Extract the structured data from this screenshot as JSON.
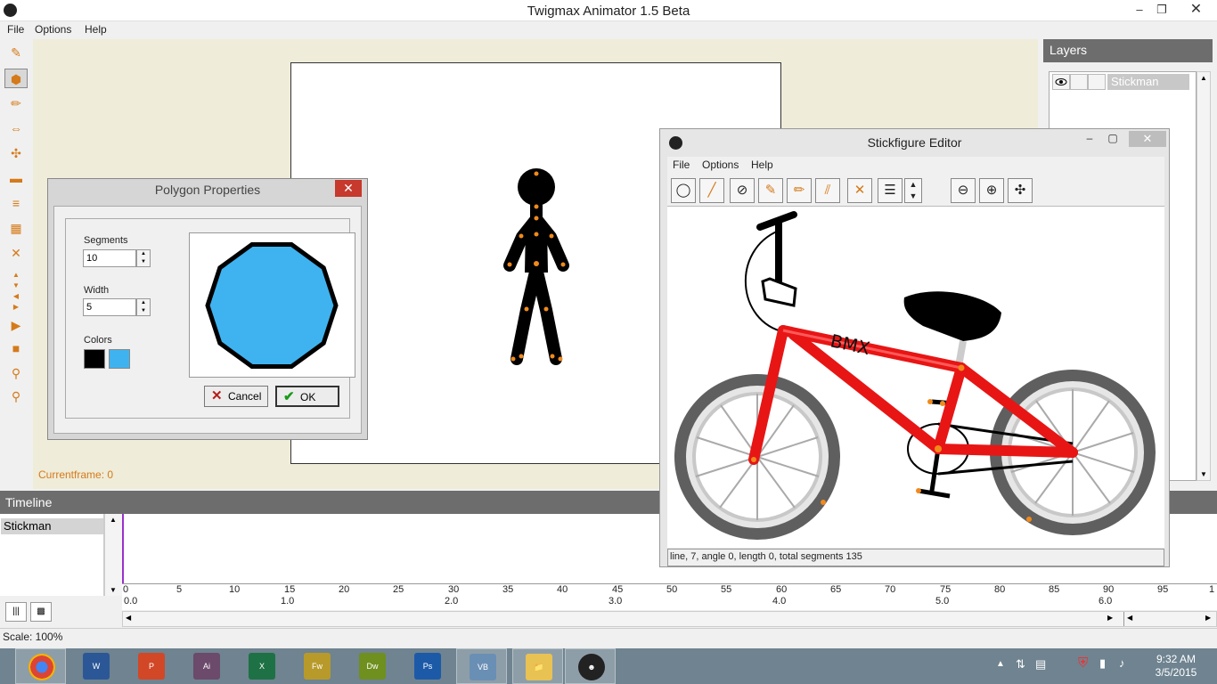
{
  "app": {
    "title": "Twigmax Animator 1.5 Beta",
    "menu": [
      "File",
      "Options",
      "Help"
    ],
    "window_controls": [
      "–",
      "❐",
      "✕"
    ]
  },
  "toolbar": {
    "tools": [
      "brush-icon",
      "polygon-icon",
      "pencil-icon",
      "resize-icon",
      "scale-icon",
      "move-icon",
      "align-icon",
      "layers-icon",
      "delete-icon",
      "up-icon",
      "down-icon",
      "left-icon",
      "right-icon",
      "play-icon",
      "stop-icon",
      "pin-icon",
      "add-pin-icon"
    ]
  },
  "canvas": {
    "currentframe": "Currentframe: 0"
  },
  "layers": {
    "header": "Layers",
    "items": [
      {
        "name": "Stickman"
      }
    ]
  },
  "timeline": {
    "header": "Timeline",
    "layers": [
      "Stickman"
    ],
    "frame_ticks": [
      "0",
      "5",
      "10",
      "15",
      "20",
      "25",
      "30",
      "35",
      "40",
      "45",
      "50",
      "55",
      "60",
      "65",
      "70",
      "75",
      "80",
      "85",
      "90",
      "95",
      "1"
    ],
    "second_ticks": [
      "0.0",
      "1.0",
      "2.0",
      "3.0",
      "4.0",
      "5.0",
      "6.0"
    ],
    "scale": "Scale: 100%"
  },
  "polygon_dialog": {
    "title": "Polygon Properties",
    "segments_label": "Segments",
    "segments_value": "10",
    "width_label": "Width",
    "width_value": "5",
    "colors_label": "Colors",
    "stroke_color": "#000000",
    "fill_color": "#3fb3ef",
    "cancel_label": "Cancel",
    "ok_label": "OK"
  },
  "stickfigure_editor": {
    "title": "Stickfigure Editor",
    "menu": [
      "File",
      "Options",
      "Help"
    ],
    "tools": [
      "circle-icon",
      "line-icon",
      "no-circle-icon",
      "pencil-icon",
      "brush-icon",
      "double-line-icon",
      "delete-icon",
      "thickness-icon",
      "zoom-out-icon",
      "zoom-in-icon",
      "fit-icon"
    ],
    "frame_text": "BMX",
    "status": "line, 7, angle 0, length 0, total segments 135",
    "accent": "#e81515"
  },
  "taskbar": {
    "apps": [
      "chrome-icon",
      "word-icon",
      "powerpoint-icon",
      "animate-icon",
      "excel-icon",
      "fireworks-icon",
      "dreamweaver-icon",
      "photoshop-icon",
      "virtualbox-icon",
      "explorer-icon",
      "twigmax-icon"
    ],
    "time": "9:32 AM",
    "date": "3/5/2015"
  }
}
